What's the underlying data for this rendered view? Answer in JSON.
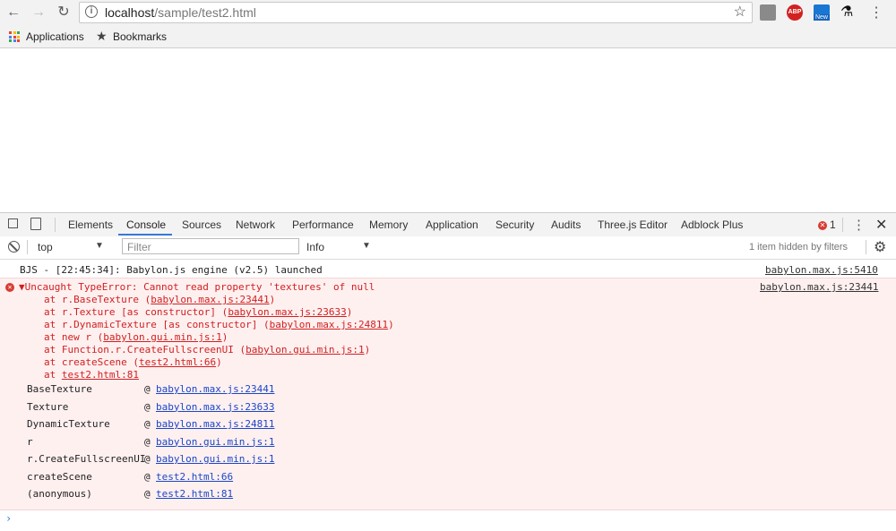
{
  "browser": {
    "back_icon": "arrow-left-icon",
    "forward_icon": "arrow-right-icon",
    "reload_icon": "reload-icon",
    "url_host": "localhost",
    "url_path": "/sample/test2.html",
    "extensions": {
      "abp_label": "ABP",
      "new_label": "New"
    }
  },
  "bookmarks": {
    "apps_label": "Applications",
    "bookmarks_label": "Bookmarks",
    "apps_colors": [
      "#ea4335",
      "#fbbc05",
      "#34a853",
      "#4285f4",
      "#ea4335",
      "#fbbc05",
      "#34a853",
      "#4285f4",
      "#ea4335"
    ]
  },
  "devtools": {
    "tabs": [
      "Elements",
      "Console",
      "Sources",
      "Network",
      "Performance",
      "Memory",
      "Application",
      "Security",
      "Audits",
      "Three.js Editor",
      "Adblock Plus"
    ],
    "active_tab": "Console",
    "error_count": "1",
    "context": "top",
    "filter_placeholder": "Filter",
    "level": "Info",
    "hidden_note": "1 item hidden by filters",
    "accent": "#3879d9"
  },
  "console": {
    "log": {
      "text": "BJS - [22:45:34]: Babylon.js engine (v2.5) launched",
      "source": "babylon.max.js:5410"
    },
    "error": {
      "message": "▼Uncaught TypeError: Cannot read property 'textures' of null",
      "source": "babylon.max.js:23441",
      "trace": [
        {
          "prefix": "at r.BaseTexture (",
          "link": "babylon.max.js:23441",
          "suffix": ")"
        },
        {
          "prefix": "at r.Texture [as constructor] (",
          "link": "babylon.max.js:23633",
          "suffix": ")"
        },
        {
          "prefix": "at r.DynamicTexture [as constructor] (",
          "link": "babylon.max.js:24811",
          "suffix": ")"
        },
        {
          "prefix": "at new r (",
          "link": "babylon.gui.min.js:1",
          "suffix": ")"
        },
        {
          "prefix": "at Function.r.CreateFullscreenUI (",
          "link": "babylon.gui.min.js:1",
          "suffix": ")"
        },
        {
          "prefix": "at createScene (",
          "link": "test2.html:66",
          "suffix": ")"
        },
        {
          "prefix": "at ",
          "link": "test2.html:81",
          "suffix": ""
        }
      ],
      "stack": [
        {
          "name": "BaseTexture",
          "link": "babylon.max.js:23441"
        },
        {
          "name": "Texture",
          "link": "babylon.max.js:23633"
        },
        {
          "name": "DynamicTexture",
          "link": "babylon.max.js:24811"
        },
        {
          "name": "r",
          "link": "babylon.gui.min.js:1"
        },
        {
          "name": "r.CreateFullscreenUI",
          "link": "babylon.gui.min.js:1"
        },
        {
          "name": "createScene",
          "link": "test2.html:66"
        },
        {
          "name": "(anonymous)",
          "link": "test2.html:81"
        }
      ],
      "at_symbol": "@"
    },
    "prompt": "›"
  }
}
